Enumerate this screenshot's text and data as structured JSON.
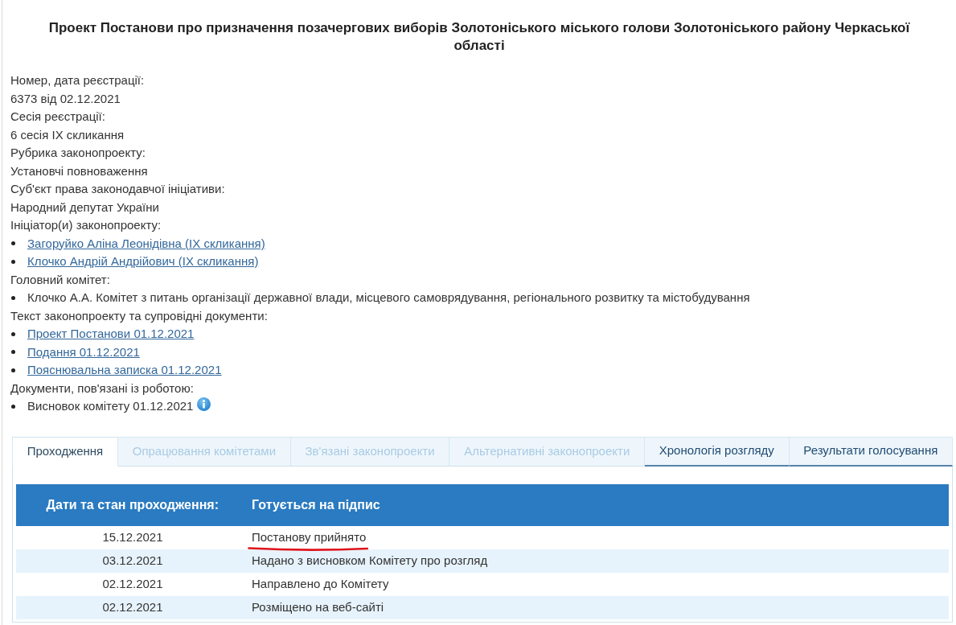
{
  "title": "Проект Постанови про призначення позачергових виборів Золотоніського міського голови Золотоніського району Черкаської області",
  "details": [
    {
      "label": "Номер, дата реєстрації:",
      "kind": "text",
      "value": "6373 від 02.12.2021"
    },
    {
      "label": "Сесія реєстрації:",
      "kind": "text",
      "value": "6 сесія IX скликання"
    },
    {
      "label": "Рубрика законопроекту:",
      "kind": "text",
      "value": "Установчі повноваження"
    },
    {
      "label": "Суб'єкт права законодавчої ініціативи:",
      "kind": "text",
      "value": "Народний депутат України"
    },
    {
      "label": "Ініціатор(и) законопроекту:",
      "kind": "list",
      "items": [
        {
          "text": "Загоруйко Аліна Леонідівна (IX скликання)",
          "link": true,
          "info": false
        },
        {
          "text": "Клочко Андрій Андрійович (IX скликання)",
          "link": true,
          "info": false
        }
      ]
    },
    {
      "label": "Головний комітет:",
      "kind": "list",
      "items": [
        {
          "text": "Клочко А.А. Комітет з питань організації державної влади, місцевого самоврядування, регіонального розвитку та містобудування",
          "link": false,
          "info": false
        }
      ]
    },
    {
      "label": "Текст законопроекту та супровідні документи:",
      "kind": "list",
      "items": [
        {
          "text": "Проект Постанови 01.12.2021",
          "link": true,
          "info": false
        },
        {
          "text": "Подання 01.12.2021",
          "link": true,
          "info": false
        },
        {
          "text": "Пояснювальна записка 01.12.2021",
          "link": true,
          "info": false
        }
      ]
    },
    {
      "label": "Документи, пов'язані із роботою:",
      "kind": "list",
      "items": [
        {
          "text": "Висновок комітету 01.12.2021",
          "link": false,
          "info": true
        }
      ]
    }
  ],
  "tabs": [
    {
      "label": "Проходження",
      "selected": true,
      "disabled": false
    },
    {
      "label": "Опрацювання комітетами",
      "selected": false,
      "disabled": true
    },
    {
      "label": "Зв'язані законопроекти",
      "selected": false,
      "disabled": true
    },
    {
      "label": "Альтернативні законопроекти",
      "selected": false,
      "disabled": true
    },
    {
      "label": "Хронологія розгляду",
      "selected": false,
      "disabled": false
    },
    {
      "label": "Результати голосування",
      "selected": false,
      "disabled": false
    }
  ],
  "table": {
    "header": {
      "label": "Дати та стан проходження:",
      "status": "Готується на підпис"
    },
    "rows": [
      {
        "date": "15.12.2021",
        "event": "Постанову прийнято",
        "underlined": true
      },
      {
        "date": "03.12.2021",
        "event": "Надано з висновком Комітету про розгляд",
        "underlined": false
      },
      {
        "date": "02.12.2021",
        "event": "Направлено до Комітету",
        "underlined": false
      },
      {
        "date": "02.12.2021",
        "event": "Розміщено на веб-сайті",
        "underlined": false
      }
    ]
  }
}
